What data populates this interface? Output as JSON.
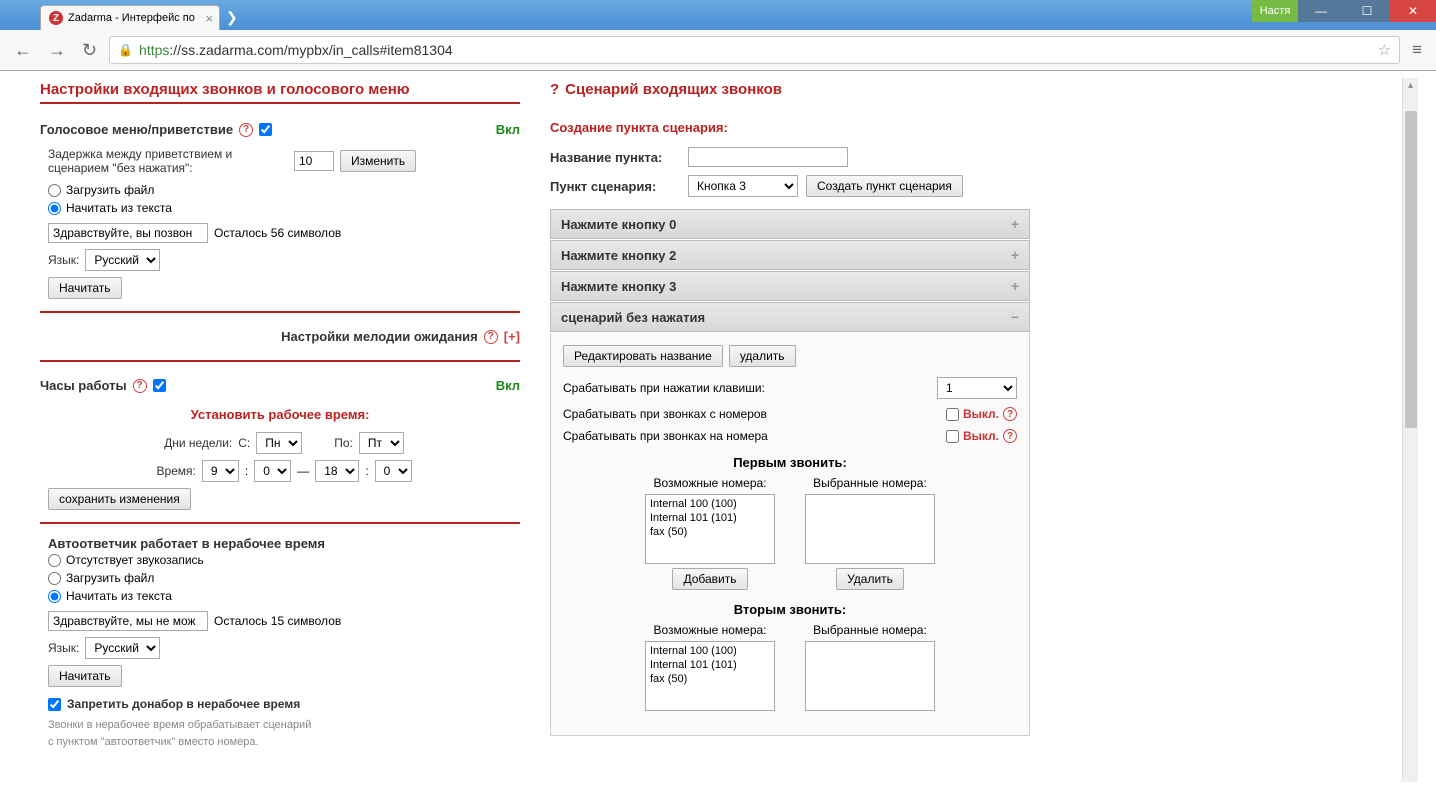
{
  "browser": {
    "tab_title": "Zadarma - Интерфейс по",
    "user": "Настя",
    "url_https": "https",
    "url_rest": "://ss.zadarma.com/mypbx/in_calls#item81304"
  },
  "left": {
    "title": "Настройки входящих звонков и голосового меню",
    "voice_menu": {
      "label": "Голосовое меню/приветствие",
      "toggle": "Вкл",
      "delay_label": "Задержка между приветствием и сценарием \"без нажатия\":",
      "delay_value": "10",
      "change_btn": "Изменить",
      "radio_upload": "Загрузить файл",
      "radio_tts": "Начитать из текста",
      "tts_text": "Здравствуйте, вы позвон",
      "chars_left": "Осталось 56 символов",
      "lang_label": "Язык:",
      "lang_value": "Русский",
      "read_btn": "Начитать"
    },
    "hold_music": {
      "label": "Настройки мелодии ожидания",
      "expand": "[+]"
    },
    "work_hours": {
      "label": "Часы работы",
      "toggle": "Вкл",
      "set_label": "Установить рабочее время:",
      "days_label": "Дни недели:",
      "from_label": "С:",
      "day_from": "Пн",
      "to_label": "По:",
      "day_to": "Пт",
      "time_label": "Время:",
      "hour_from": "9",
      "min_from": "0",
      "hour_to": "18",
      "min_to": "0",
      "save_btn": "сохранить изменения"
    },
    "answering": {
      "title": "Автоответчик работает в нерабочее время",
      "radio_none": "Отсутствует звукозапись",
      "radio_upload": "Загрузить файл",
      "radio_tts": "Начитать из текста",
      "tts_text": "Здравствуйте, мы не мож",
      "chars_left": "Осталось 15 символов",
      "lang_label": "Язык:",
      "lang_value": "Русский",
      "read_btn": "Начитать",
      "deny_label": "Запретить донабор в нерабочее время",
      "deny_note1": "Звонки в нерабочее время обрабатывает сценарий",
      "deny_note2": "с пунктом \"автоответчик\" вместо номера."
    }
  },
  "right": {
    "title": "Сценарий входящих звонков",
    "create_label": "Создание пункта сценария:",
    "name_label": "Название пункта:",
    "name_value": "",
    "point_label": "Пункт сценария:",
    "point_value": "Кнопка 3",
    "create_btn": "Создать пункт сценария",
    "accordion": [
      "Нажмите кнопку 0",
      "Нажмите кнопку 2",
      "Нажмите кнопку 3",
      "сценарий без нажатия"
    ],
    "body": {
      "edit_btn": "Редактировать название",
      "delete_btn": "удалить",
      "trigger_key_label": "Срабатывать при нажатии клавиши:",
      "trigger_key_value": "1",
      "trigger_from_label": "Срабатывать при звонках с номеров",
      "trigger_to_label": "Срабатывать при звонках на номера",
      "off_state": "Выкл.",
      "first_call": "Первым звонить:",
      "second_call": "Вторым звонить:",
      "possible_label": "Возможные номера:",
      "selected_label": "Выбранные номера:",
      "numbers": [
        "Internal 100 (100)",
        "Internal 101 (101)",
        "fax (50)"
      ],
      "add_btn": "Добавить",
      "remove_btn": "Удалить"
    }
  }
}
